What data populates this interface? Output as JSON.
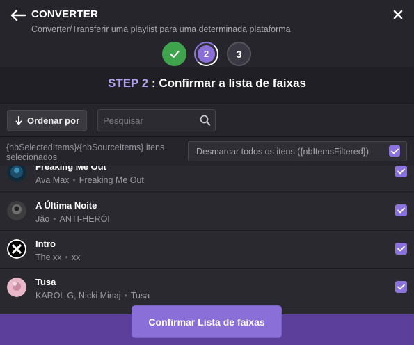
{
  "header": {
    "title": "CONVERTER",
    "subtitle": "Converter/Transferir uma playlist para uma determinada plataforma"
  },
  "stepper": {
    "steps": [
      {
        "label": "",
        "state": "done"
      },
      {
        "label": "2",
        "state": "active"
      },
      {
        "label": "3",
        "state": "pending"
      }
    ]
  },
  "step_heading": {
    "step_label": "STEP 2",
    "separator": " : ",
    "text": "Confirmar a lista de faixas"
  },
  "toolbar": {
    "sort_label": "Ordenar por",
    "search_placeholder": "Pesquisar"
  },
  "selection": {
    "count_text": "{nbSelectedItems}/{nbSourceItems} itens selecionados",
    "deselect_label": "Desmarcar todos os itens ({nbItemsFiltered})"
  },
  "tracks": [
    {
      "name": "Freaking Me Out",
      "artist": "Ava Max",
      "album": "Freaking Me Out",
      "checked": true
    },
    {
      "name": "A Última Noite",
      "artist": "Jão",
      "album": "ANTI-HERÓI",
      "checked": true
    },
    {
      "name": "Intro",
      "artist": "The xx",
      "album": "xx",
      "checked": true
    },
    {
      "name": "Tusa",
      "artist": "KAROL G, Nicki Minaj",
      "album": "Tusa",
      "checked": true
    }
  ],
  "footer": {
    "confirm_label": "Confirmar Lista de faixas"
  },
  "colors": {
    "accent": "#8a6fd9",
    "success": "#3fa34d",
    "background": "#26252b"
  }
}
